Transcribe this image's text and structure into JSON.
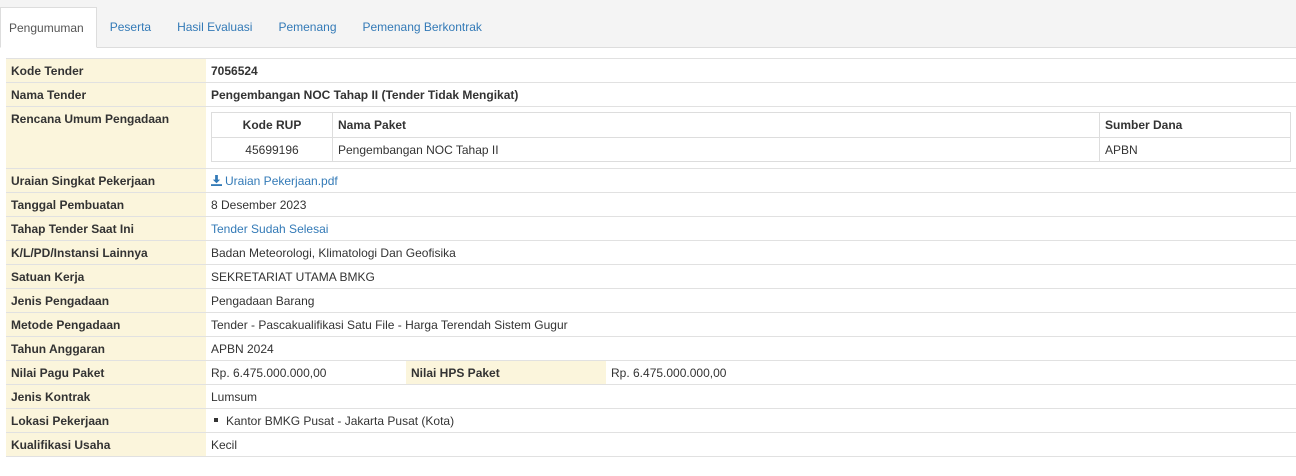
{
  "tabs": [
    {
      "label": "Pengumuman",
      "active": true
    },
    {
      "label": "Peserta",
      "active": false
    },
    {
      "label": "Hasil Evaluasi",
      "active": false
    },
    {
      "label": "Pemenang",
      "active": false
    },
    {
      "label": "Pemenang Berkontrak",
      "active": false
    }
  ],
  "fields": {
    "kode_tender": {
      "label": "Kode Tender",
      "value": "7056524"
    },
    "nama_tender": {
      "label": "Nama Tender",
      "value": "Pengembangan NOC Tahap II (Tender Tidak Mengikat)"
    },
    "rup": {
      "label": "Rencana Umum Pengadaan",
      "headers": [
        "Kode RUP",
        "Nama Paket",
        "Sumber Dana"
      ],
      "rows": [
        [
          "45699196",
          "Pengembangan NOC Tahap II",
          "APBN"
        ]
      ]
    },
    "uraian": {
      "label": "Uraian Singkat Pekerjaan",
      "value": "Uraian Pekerjaan.pdf",
      "icon": "download-icon"
    },
    "tanggal": {
      "label": "Tanggal Pembuatan",
      "value": "8 Desember 2023"
    },
    "tahap": {
      "label": "Tahap Tender Saat Ini",
      "value": "Tender Sudah Selesai"
    },
    "instansi": {
      "label": "K/L/PD/Instansi Lainnya",
      "value": "Badan Meteorologi, Klimatologi Dan Geofisika"
    },
    "satker": {
      "label": "Satuan Kerja",
      "value": "SEKRETARIAT UTAMA BMKG"
    },
    "jenis_pengadaan": {
      "label": "Jenis Pengadaan",
      "value": "Pengadaan Barang"
    },
    "metode": {
      "label": "Metode Pengadaan",
      "value": "Tender - Pascakualifikasi Satu File - Harga Terendah Sistem Gugur"
    },
    "tahun": {
      "label": "Tahun Anggaran",
      "value": "APBN 2024"
    },
    "pagu": {
      "label": "Nilai Pagu Paket",
      "value": "Rp. 6.475.000.000,00"
    },
    "hps": {
      "label": "Nilai HPS Paket",
      "value": "Rp. 6.475.000.000,00"
    },
    "kontrak": {
      "label": "Jenis Kontrak",
      "value": "Lumsum"
    },
    "lokasi": {
      "label": "Lokasi Pekerjaan",
      "value": "Kantor BMKG Pusat - Jakarta Pusat (Kota)"
    },
    "kualifikasi": {
      "label": "Kualifikasi Usaha",
      "value": "Kecil"
    }
  },
  "colors": {
    "label_bg": "#fbf5dc",
    "link": "#337ab7",
    "border": "#e1e1e1"
  }
}
